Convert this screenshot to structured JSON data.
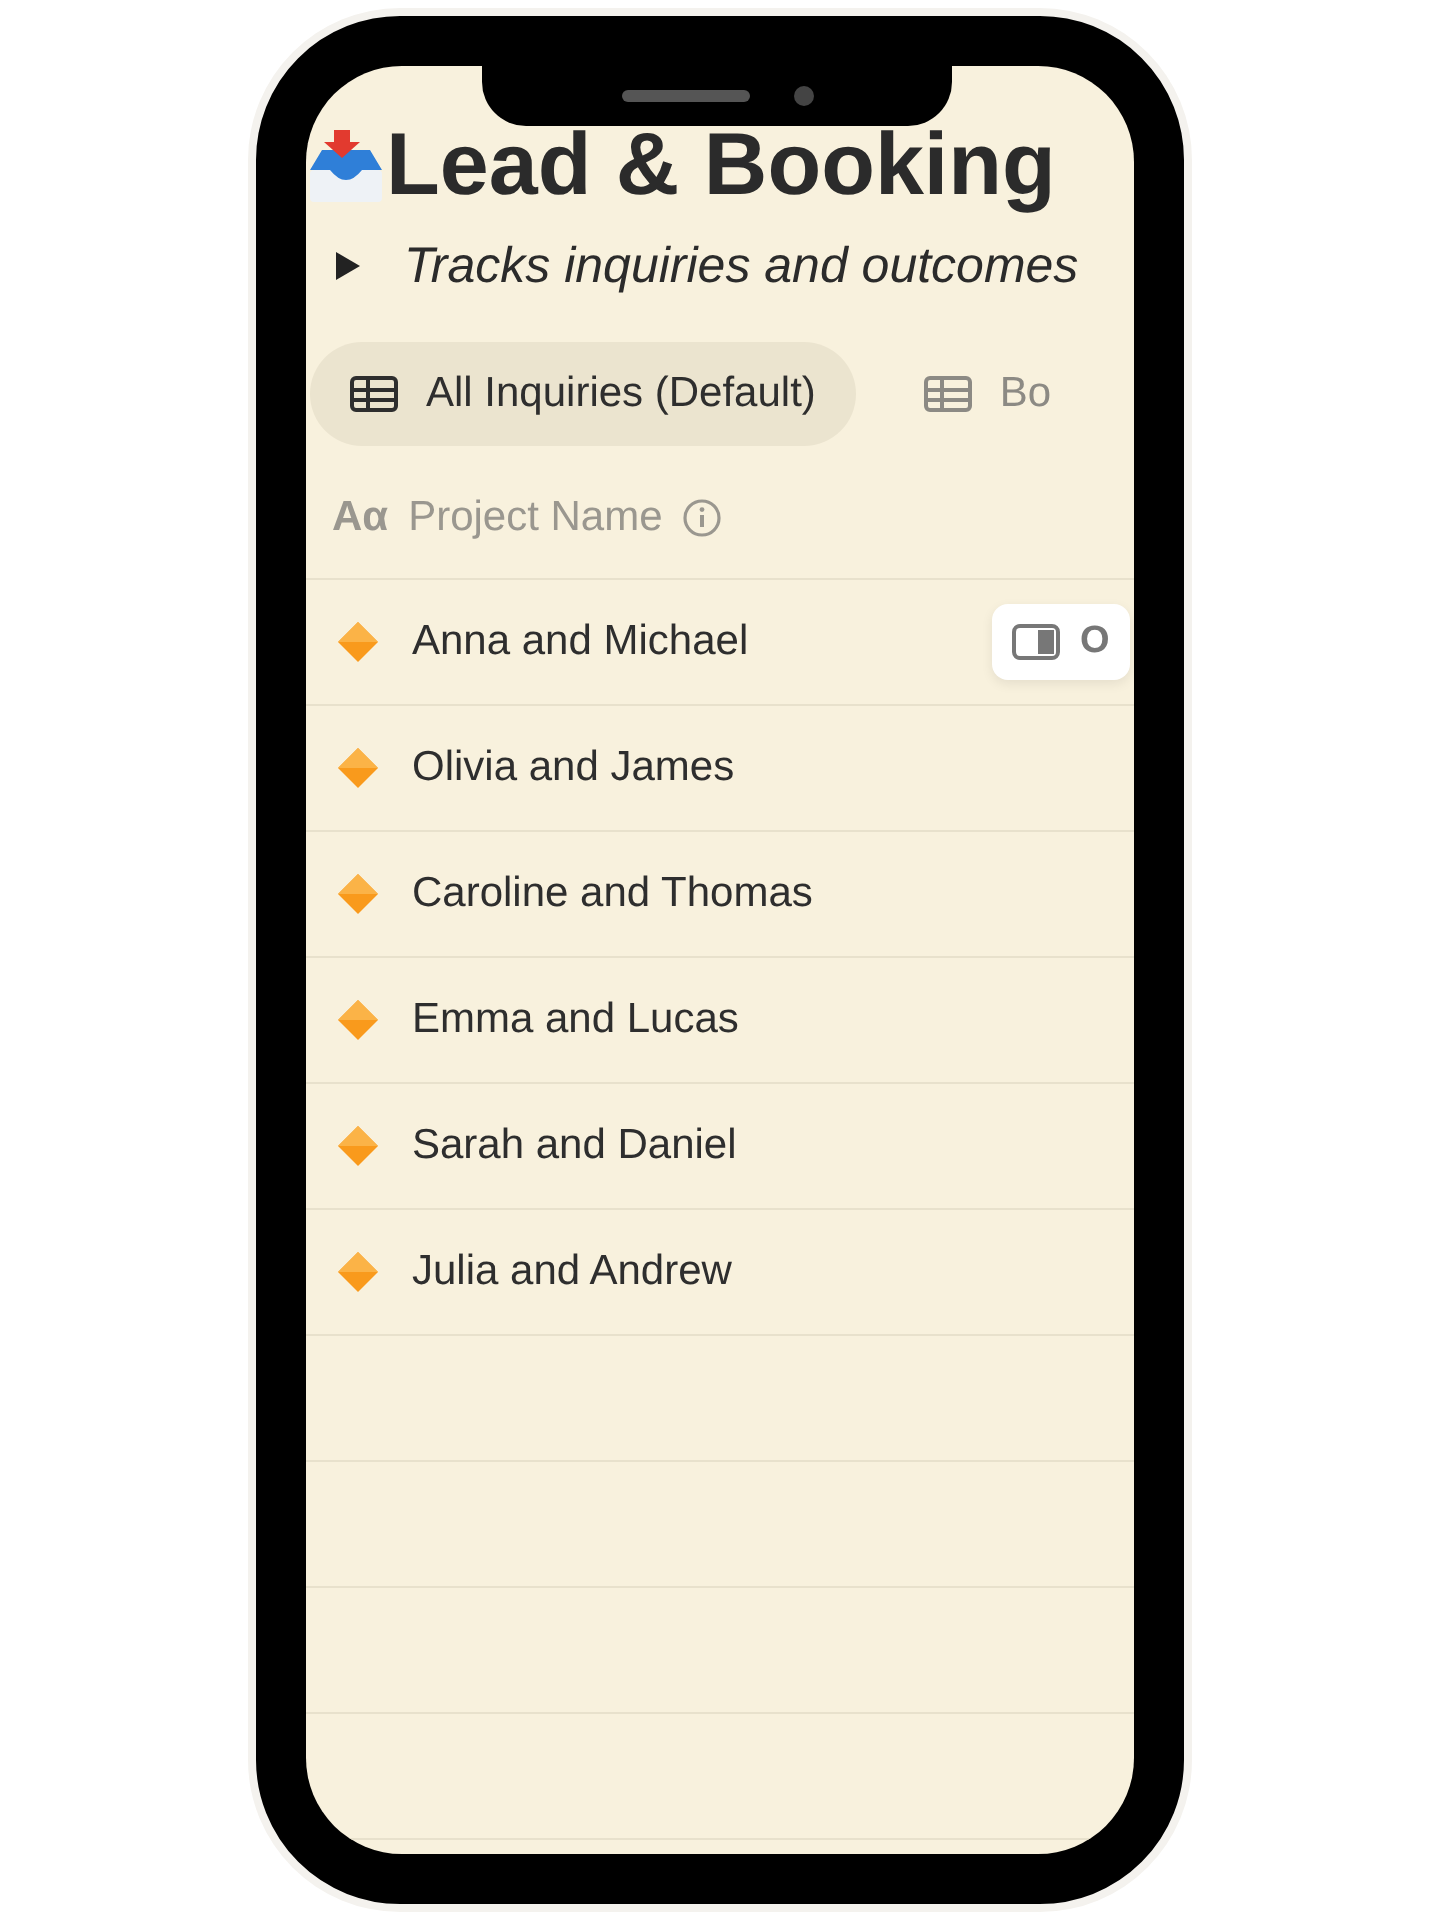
{
  "page": {
    "title": "Lead & Booking",
    "description": "Tracks inquiries and outcomes",
    "description_expanded": false
  },
  "views": [
    {
      "label": "All Inquiries (Default)",
      "selected": true
    },
    {
      "label": "Bo",
      "selected": false
    }
  ],
  "table": {
    "columns": [
      {
        "type_icon": "Aα",
        "label": "Project Name"
      }
    ],
    "rows": [
      {
        "name": "Anna and Michael",
        "open_button": "O"
      },
      {
        "name": "Olivia and James"
      },
      {
        "name": "Caroline and Thomas"
      },
      {
        "name": "Emma and Lucas"
      },
      {
        "name": "Sarah and Daniel"
      },
      {
        "name": "Julia and Andrew"
      }
    ]
  }
}
